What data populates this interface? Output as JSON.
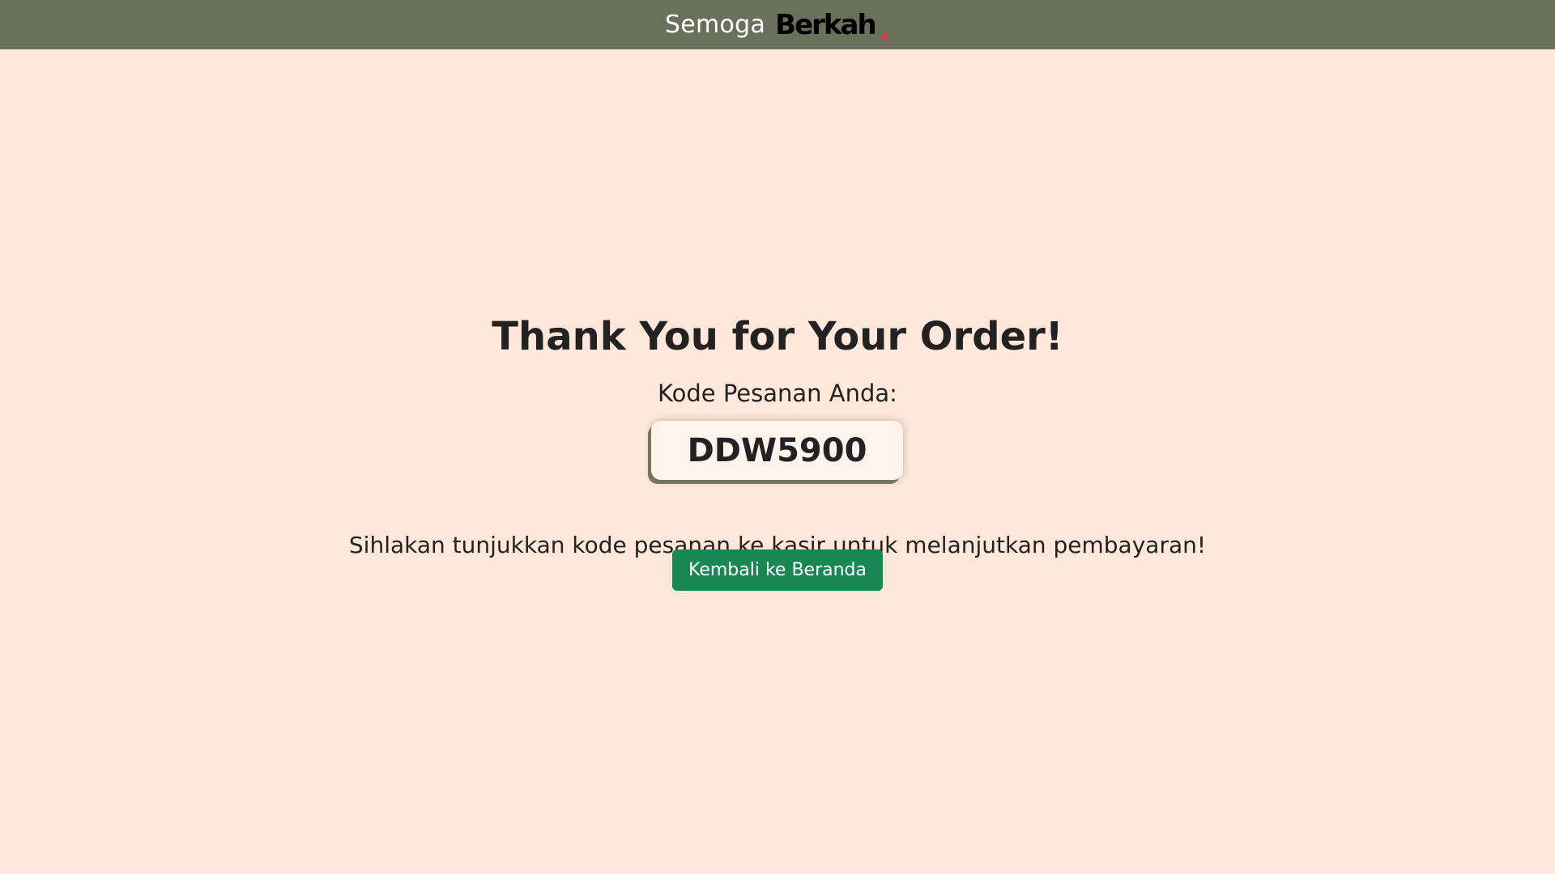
{
  "header": {
    "brand_prefix": "Semoga",
    "brand_main": "Berkah",
    "brand_dot": ".",
    "background_color": "#6b705c",
    "brand_prefix_color": "#ffffff",
    "brand_main_color": "#000000",
    "brand_dot_color": "#e63946"
  },
  "page": {
    "background_color": "#ffe8d9",
    "headline": "Thank You for Your Order!",
    "code_label": "Kode Pesanan Anda:",
    "order_code": "DDW5900",
    "instruction": "Sihlakan tunjukkan kode pesanan ke kasir untuk melanjutkan pembayaran!",
    "back_button_label": "Kembali ke Beranda",
    "button_color": "#198754"
  }
}
